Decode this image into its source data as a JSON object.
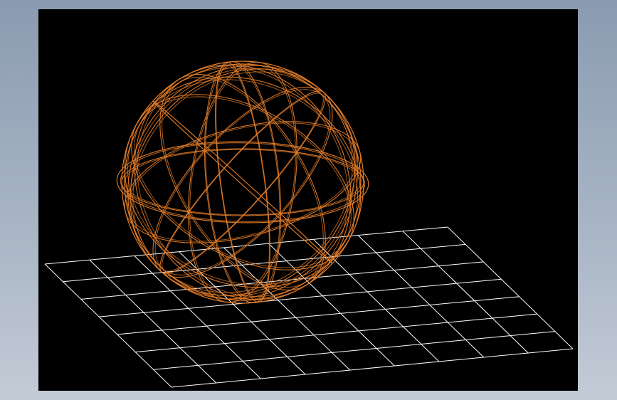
{
  "viewport": {
    "background_color": "#000000",
    "grid_color": "#ffffff",
    "model_color": "#e07b28"
  },
  "scene": {
    "grid": {
      "rows": 7,
      "cols": 9
    },
    "model": {
      "type": "wireframe-sphere",
      "ring_count": 14
    }
  }
}
